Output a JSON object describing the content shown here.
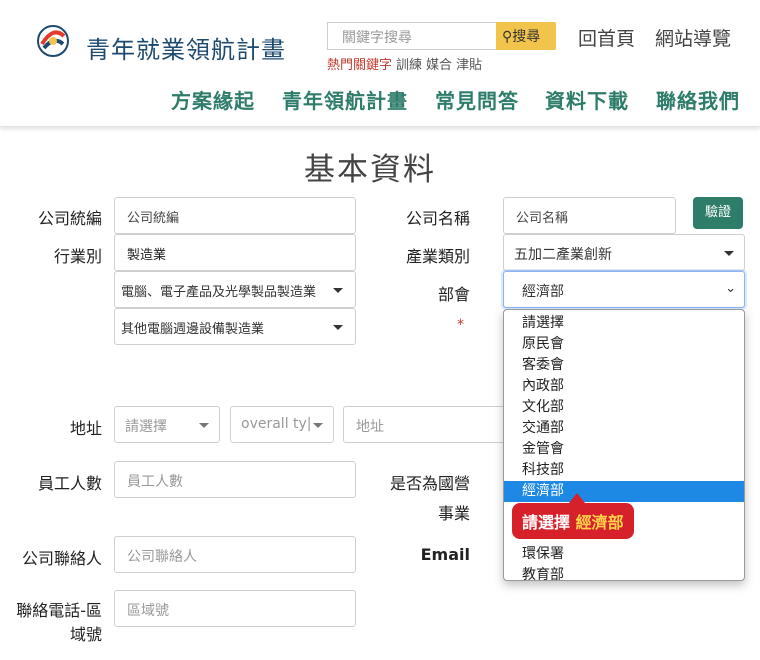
{
  "header": {
    "logo_text": "青年就業領航計畫",
    "search_placeholder": "關鍵字搜尋",
    "search_button": "搜尋",
    "hot_label": "熱門關鍵字",
    "hot_keywords": [
      "訓練",
      "媒合",
      "津貼"
    ],
    "home_link": "回首頁",
    "sitemap_link": "網站導覽"
  },
  "nav": [
    "方案緣起",
    "青年領航計畫",
    "常見問答",
    "資料下載",
    "聯絡我們"
  ],
  "page_title": "基本資料",
  "form": {
    "tax_id_label": "公司統編",
    "tax_id_placeholder": "公司統編",
    "company_name_label": "公司名稱",
    "company_name_placeholder": "公司名稱",
    "verify_button": "驗證",
    "industry_label": "行業別",
    "industry_value": "製造業",
    "industry_sub1_value": "電腦、電子產品及光學製品製造業",
    "industry_sub2_value": "其他電腦週邊設備製造業",
    "sector_label": "產業類別",
    "sector_value": "五加二產業創新",
    "ministry_label": "部會",
    "ministry_value": "經濟部",
    "required_mark": "*",
    "address_label": "地址",
    "address_city_placeholder": "請選擇",
    "address_district_placeholder": "overall ty|",
    "address_placeholder": "地址",
    "employees_label": "員工人數",
    "employees_placeholder": "員工人數",
    "state_owned_label_line1": "是否為國營",
    "state_owned_label_line2": "事業",
    "contact_label": "公司聯絡人",
    "contact_placeholder": "公司聯絡人",
    "email_label": "Email",
    "phone_label_line1": "聯絡電話-區",
    "phone_label_line2": "域號",
    "phone_placeholder": "區域號"
  },
  "ministry_dropdown": {
    "options": [
      "請選擇",
      "原民會",
      "客委會",
      "內政部",
      "文化部",
      "交通部",
      "金管會",
      "科技部",
      "經濟部",
      "",
      "",
      "環保署",
      "教育部"
    ],
    "selected": "經濟部"
  },
  "callout": {
    "prefix": "請選擇",
    "highlight": "經濟部"
  }
}
